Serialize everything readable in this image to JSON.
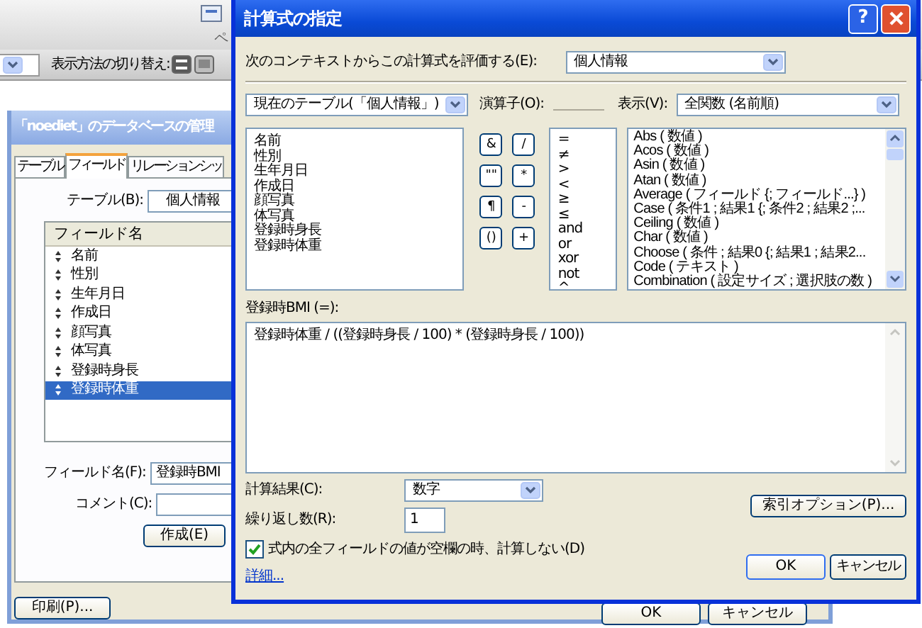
{
  "app_toolbar": {
    "label_fragment": "ペ",
    "view_switch_label": "表示方法の切り替え:",
    "view_buttons": [
      {
        "selected": true
      },
      {
        "selected": false
      }
    ]
  },
  "manage_dialog": {
    "title": "「noediet」のデータベースの管理",
    "tabs": [
      {
        "label": "テーブル",
        "selected": false
      },
      {
        "label": "フィールド",
        "selected": true
      },
      {
        "label": "リレーションシッ",
        "selected": false
      }
    ],
    "table_label": "テーブル(B):",
    "table_value": "個人情報",
    "field_list": {
      "header": "フィールド名",
      "items": [
        {
          "label": "名前",
          "selected": false
        },
        {
          "label": "性別",
          "selected": false
        },
        {
          "label": "生年月日",
          "selected": false
        },
        {
          "label": "作成日",
          "selected": false
        },
        {
          "label": "顔写真",
          "selected": false
        },
        {
          "label": "体写真",
          "selected": false
        },
        {
          "label": "登録時身長",
          "selected": false
        },
        {
          "label": "登録時体重",
          "selected": true
        }
      ]
    },
    "field_name_label": "フィールド名(F):",
    "field_name_value": "登録時BMI",
    "comment_label": "コメント(C):",
    "create_button": "作成(E)",
    "print_button": "印刷(P)...",
    "ok_button": "OK",
    "cancel_button": "キャンセル"
  },
  "calc_dialog": {
    "title": "計算式の指定",
    "help_button": "?",
    "context_label": "次のコンテキストからこの計算式を評価する(E):",
    "context_value": "個人情報",
    "table_select": "現在のテーブル(「個人情報」)",
    "fields": [
      "名前",
      "性別",
      "生年月日",
      "作成日",
      "顔写真",
      "体写真",
      "登録時身長",
      "登録時体重"
    ],
    "operators_label": "演算子(O):",
    "operator_buttons": [
      "&",
      "/",
      "\"\"",
      "*",
      "¶",
      "-",
      "()",
      "+"
    ],
    "operator_list": [
      "=",
      "≠",
      ">",
      "<",
      "≥",
      "≤",
      "and",
      "or",
      "xor",
      "not",
      "^"
    ],
    "view_label": "表示(V):",
    "view_value": "全関数 (名前順)",
    "functions": [
      "Abs ( 数値 )",
      "Acos ( 数値 )",
      "Asin ( 数値 )",
      "Atan ( 数値 )",
      "Average ( フィールド {; フィールド...} )",
      "Case ( 条件1 ; 結果1 {; 条件2 ; 結果2 ;...",
      "Ceiling ( 数値 )",
      "Char ( 数値 )",
      "Choose ( 条件 ; 結果0 {; 結果1 ; 結果2...",
      "Code ( テキスト )",
      "Combination ( 設定サイズ ; 選択肢の数 )"
    ],
    "formula_label": "登録時BMI (=):",
    "formula": "登録時体重 / ((登録時身長 / 100) * (登録時身長 / 100))",
    "result_label": "計算結果(C):",
    "result_value": "数字",
    "repeat_label": "繰り返し数(R):",
    "repeat_value": "1",
    "index_button": "索引オプション(P)...",
    "skip_empty": {
      "label": "式内の全フィールドの値が空欄の時、計算しない(D)",
      "checked": true
    },
    "details_link": "詳細...",
    "ok_button": "OK",
    "cancel_button": "キャンセル"
  }
}
